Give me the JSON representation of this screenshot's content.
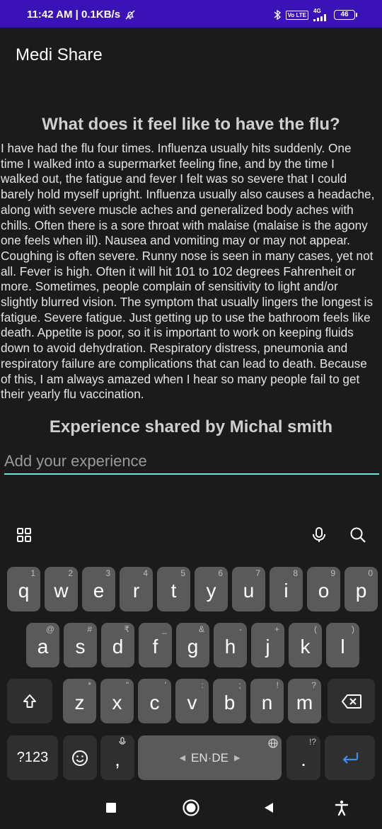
{
  "status_bar": {
    "time_speed": "11:42 AM | 0.1KB/s",
    "network": "4G",
    "volte": "Vo LTE",
    "battery": "46"
  },
  "app": {
    "title": "Medi Share"
  },
  "post": {
    "title": "What does it feel like to have the flu?",
    "body": "I have had the flu four times. Influenza usually hits suddenly. One time I walked into a supermarket feeling fine, and by the time I walked out, the fatigue and fever I felt was so severe that I could barely hold myself upright.  Influenza usually also causes a headache, along with severe muscle aches and generalized body aches with chills. Often there is a sore throat with malaise (malaise is the agony one feels when ill). Nausea and vomiting may or may not appear. Coughing is often severe. Runny nose is seen in many cases, yet not all. Fever is high. Often it will hit 101 to 102 degrees Fahrenheit or more. Sometimes, people complain of sensitivity to light and/or slightly blurred vision. The symptom that usually lingers the longest is fatigue. Severe fatigue. Just getting up to use the bathroom feels like death. Appetite is poor, so it is important to work on keeping fluids down to avoid dehydration. Respiratory distress, pneumonia and respiratory failure are complications that can lead to death. Because of this, I am always amazed when I hear so many people fail to get their yearly flu vaccination.",
    "shared_by": "Experience shared by Michal smith"
  },
  "experience_input": {
    "placeholder": "Add your experience",
    "value": ""
  },
  "keyboard": {
    "row1": [
      {
        "char": "q",
        "hint": "1"
      },
      {
        "char": "w",
        "hint": "2"
      },
      {
        "char": "e",
        "hint": "3"
      },
      {
        "char": "r",
        "hint": "4"
      },
      {
        "char": "t",
        "hint": "5"
      },
      {
        "char": "y",
        "hint": "6"
      },
      {
        "char": "u",
        "hint": "7"
      },
      {
        "char": "i",
        "hint": "8"
      },
      {
        "char": "o",
        "hint": "9"
      },
      {
        "char": "p",
        "hint": "0"
      }
    ],
    "row2": [
      {
        "char": "a",
        "hint": "@"
      },
      {
        "char": "s",
        "hint": "#"
      },
      {
        "char": "d",
        "hint": "₹"
      },
      {
        "char": "f",
        "hint": "_"
      },
      {
        "char": "g",
        "hint": "&"
      },
      {
        "char": "h",
        "hint": "-"
      },
      {
        "char": "j",
        "hint": "+"
      },
      {
        "char": "k",
        "hint": "("
      },
      {
        "char": "l",
        "hint": ")"
      }
    ],
    "row3": [
      {
        "char": "z",
        "hint": "*"
      },
      {
        "char": "x",
        "hint": "\""
      },
      {
        "char": "c",
        "hint": "'"
      },
      {
        "char": "v",
        "hint": ":"
      },
      {
        "char": "b",
        "hint": ";"
      },
      {
        "char": "n",
        "hint": "!"
      },
      {
        "char": "m",
        "hint": "?"
      }
    ],
    "symbols_label": "?123",
    "comma": ",",
    "comma_hint": "mic",
    "space_label": "EN·DE",
    "period": ".",
    "period_hint": "!?"
  },
  "colors": {
    "status_bar": "#3a12b8",
    "accent_underline": "#6fe5d6",
    "enter_icon": "#3d8ef0"
  }
}
